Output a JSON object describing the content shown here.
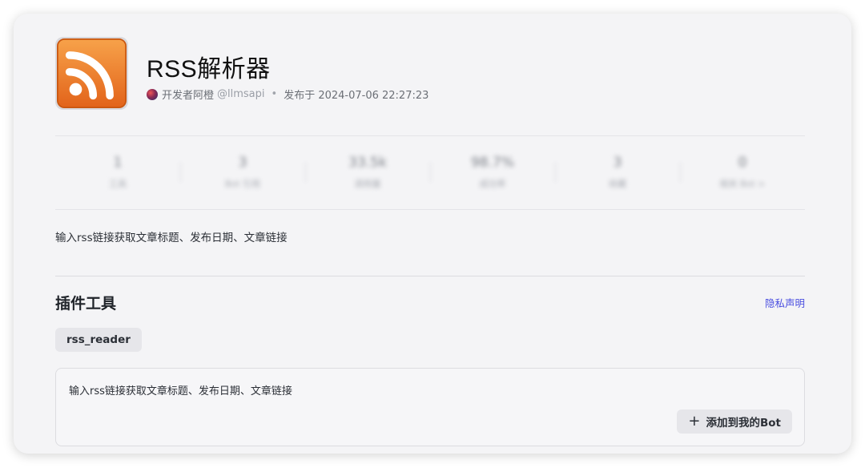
{
  "plugin": {
    "name": "RSS解析器",
    "developer": "开发者阿橙",
    "handle": "@llmsapi",
    "separator": "•",
    "published": "发布于 2024-07-06 22:27:23",
    "description": "输入rss链接获取文章标题、发布日期、文章链接"
  },
  "stats": [
    {
      "value": "1",
      "label": "工具"
    },
    {
      "value": "3",
      "label": "Bot 引用"
    },
    {
      "value": "33.5k",
      "label": "调用量"
    },
    {
      "value": "98.7%",
      "label": "成功率"
    },
    {
      "value": "3",
      "label": "收藏"
    },
    {
      "value": "0",
      "label": "相关 Bot >"
    }
  ],
  "section": {
    "title": "插件工具",
    "privacy_label": "隐私声明"
  },
  "tool": {
    "name": "rss_reader",
    "description": "输入rss链接获取文章标题、发布日期、文章链接",
    "add_icon": "+",
    "add_label": "添加到我的Bot"
  },
  "colors": {
    "accent": "#4b4fe0",
    "rss_orange": "#f07d1e",
    "card_bg": "#f4f4f6"
  },
  "icons": {
    "logo": "rss-icon",
    "add": "plus-icon"
  }
}
